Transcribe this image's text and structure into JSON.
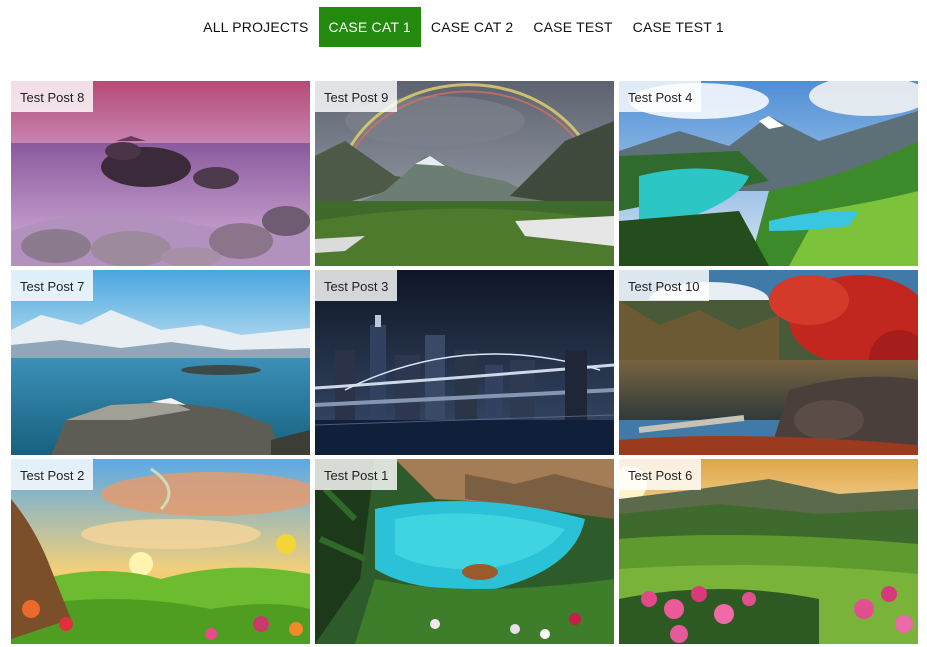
{
  "filters": {
    "items": [
      {
        "label": "ALL PROJECTS",
        "active": false
      },
      {
        "label": "CASE CAT 1",
        "active": true
      },
      {
        "label": "CASE CAT 2",
        "active": false
      },
      {
        "label": "CASE TEST",
        "active": false
      },
      {
        "label": "CASE TEST 1",
        "active": false
      }
    ],
    "active_color": "#238a0e"
  },
  "posts": [
    {
      "title": "Test Post 8",
      "scene": "purple-rocky-beach"
    },
    {
      "title": "Test Post 9",
      "scene": "rainbow-mountain-valley"
    },
    {
      "title": "Test Post 4",
      "scene": "turquoise-mountain-lake"
    },
    {
      "title": "Test Post 7",
      "scene": "snowy-coast-rocks"
    },
    {
      "title": "Test Post 3",
      "scene": "city-bridge-night"
    },
    {
      "title": "Test Post 10",
      "scene": "autumn-red-trees-lake"
    },
    {
      "title": "Test Post 2",
      "scene": "fantasy-meadow-flowers"
    },
    {
      "title": "Test Post 1",
      "scene": "tropical-cove-lagoon"
    },
    {
      "title": "Test Post 6",
      "scene": "sunset-valley-rhododendrons"
    }
  ]
}
